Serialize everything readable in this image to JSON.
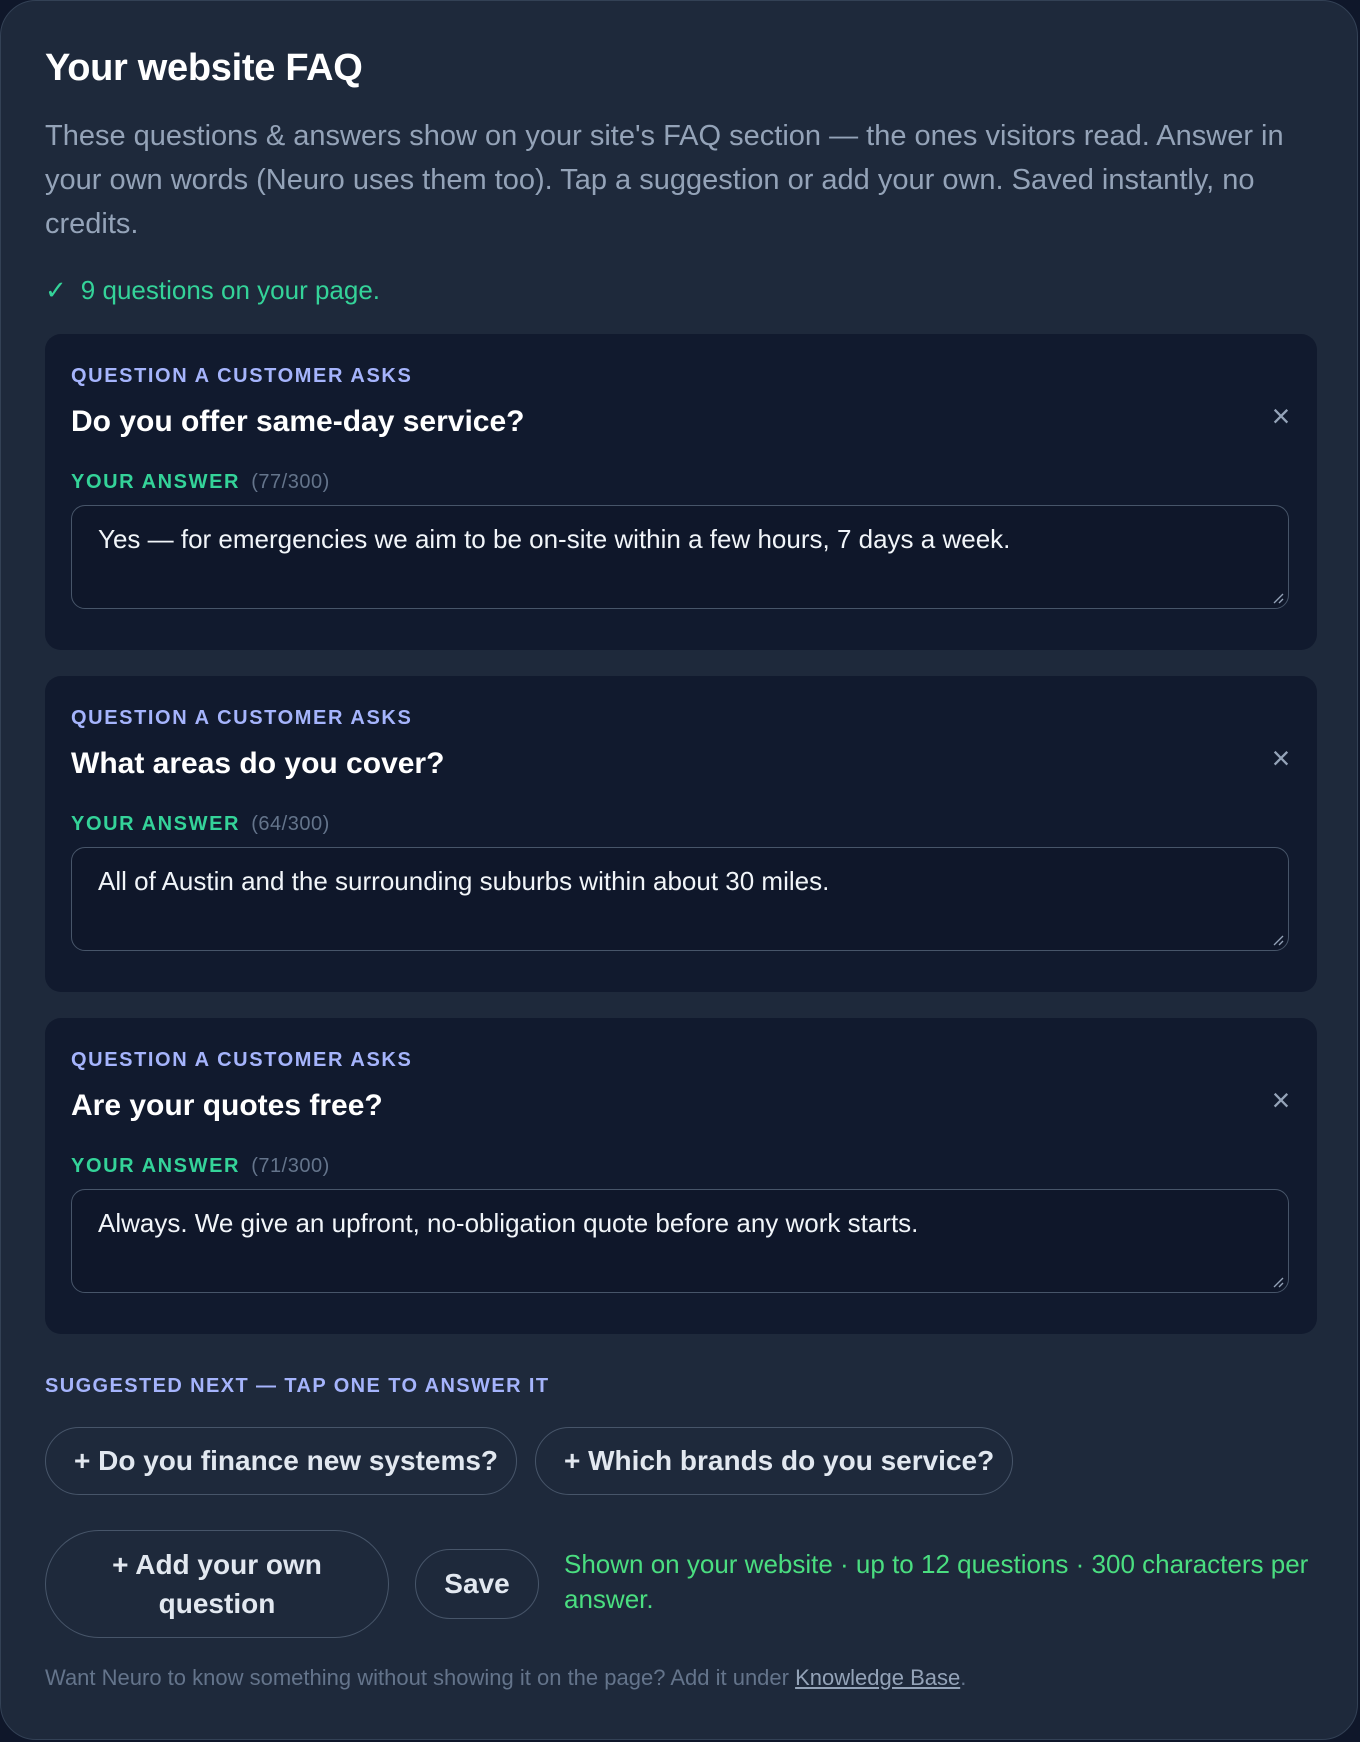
{
  "header": {
    "title": "Your website FAQ",
    "intro": "These questions & answers show on your site's FAQ section — the ones visitors read. Answer in your own words (Neuro uses them too). Tap a suggestion or add your own. Saved instantly, no credits."
  },
  "status": {
    "check_icon": "✓",
    "text": "9 questions on your page."
  },
  "faq": {
    "question_label": "QUESTION A CUSTOMER ASKS",
    "answer_label": "YOUR ANSWER",
    "close_icon": "×",
    "items": [
      {
        "question": "Do you offer same-day service?",
        "counter": "(77/300)",
        "answer": "Yes — for emergencies we aim to be on-site within a few hours, 7 days a week."
      },
      {
        "question": "What areas do you cover?",
        "counter": "(64/300)",
        "answer": "All of Austin and the surrounding suburbs within about 30 miles."
      },
      {
        "question": "Are your quotes free?",
        "counter": "(71/300)",
        "answer": "Always. We give an upfront, no-obligation quote before any work starts."
      }
    ]
  },
  "suggestions": {
    "label": "SUGGESTED NEXT — TAP ONE TO ANSWER IT",
    "items": [
      "+ Do you finance new systems?",
      "+ Which brands do you service?"
    ]
  },
  "actions": {
    "add_label": "+ Add your own question",
    "save_label": "Save",
    "note": "Shown on your website · up to 12 questions · 300 characters per answer."
  },
  "footer": {
    "text_before": "Want Neuro to know something without showing it on the page? Add it under ",
    "link_text": "Knowledge Base",
    "text_after": "."
  },
  "colors": {
    "background": "#1e293b",
    "card": "#111a2e",
    "accent_indigo": "#a5b4fc",
    "accent_green": "#34d399",
    "muted": "#94a3b8"
  }
}
